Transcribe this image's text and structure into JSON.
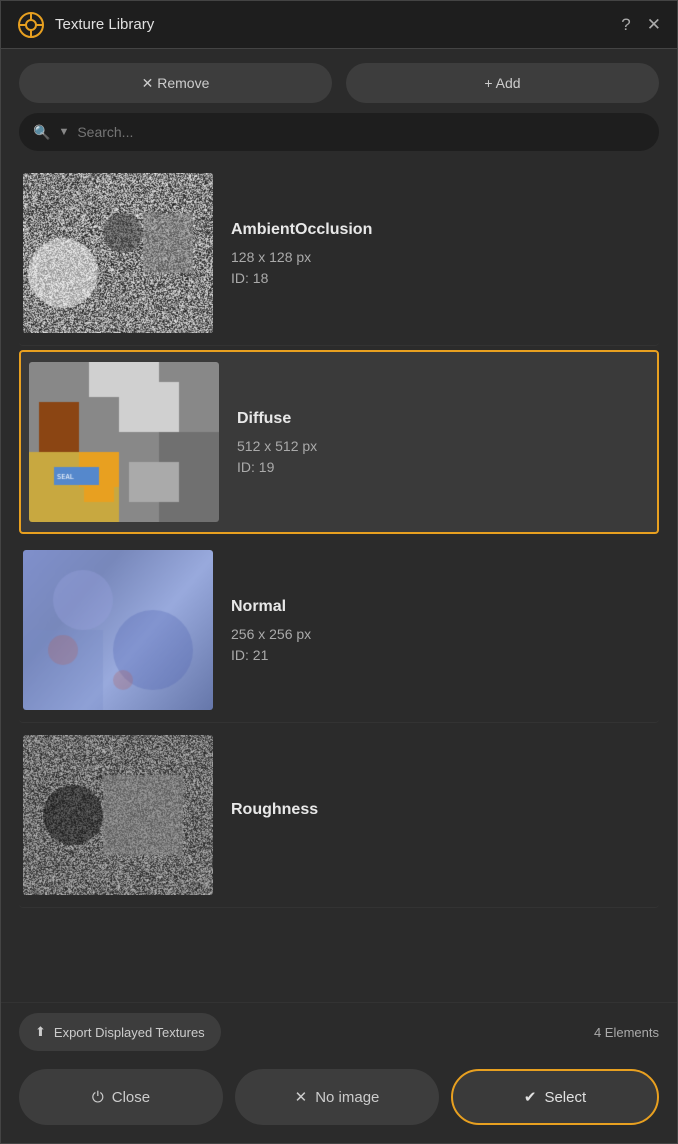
{
  "window": {
    "title": "Texture Library",
    "help_label": "?",
    "close_label": "✕"
  },
  "toolbar": {
    "remove_label": "✕  Remove",
    "add_label": "+  Add"
  },
  "search": {
    "placeholder": "Search...",
    "icon": "🔍",
    "arrow": "▼"
  },
  "textures": [
    {
      "id": "ambient-occlusion",
      "name": "AmbientOcclusion",
      "size": "128 x 128 px",
      "id_label": "ID: 18",
      "type": "ao",
      "selected": false
    },
    {
      "id": "diffuse",
      "name": "Diffuse",
      "size": "512 x 512 px",
      "id_label": "ID: 19",
      "type": "diffuse",
      "selected": true
    },
    {
      "id": "normal",
      "name": "Normal",
      "size": "256 x 256 px",
      "id_label": "ID: 21",
      "type": "normal",
      "selected": false
    },
    {
      "id": "roughness",
      "name": "Roughness",
      "size": "",
      "id_label": "",
      "type": "roughness",
      "selected": false
    }
  ],
  "footer": {
    "export_label": "Export Displayed Textures",
    "export_icon": "⬆",
    "elements_count": "4 Elements"
  },
  "bottom_bar": {
    "close_label": "Close",
    "close_icon": "⏻",
    "no_image_label": "No image",
    "no_image_icon": "✕",
    "select_label": "Select",
    "select_icon": "✔"
  },
  "colors": {
    "accent": "#e8a020",
    "selected_bg": "#3a3a3a",
    "button_bg": "#3d3d3d",
    "bg": "#2b2b2b",
    "dark_bg": "#1e1e1e"
  },
  "logo": {
    "label": "⊗"
  }
}
